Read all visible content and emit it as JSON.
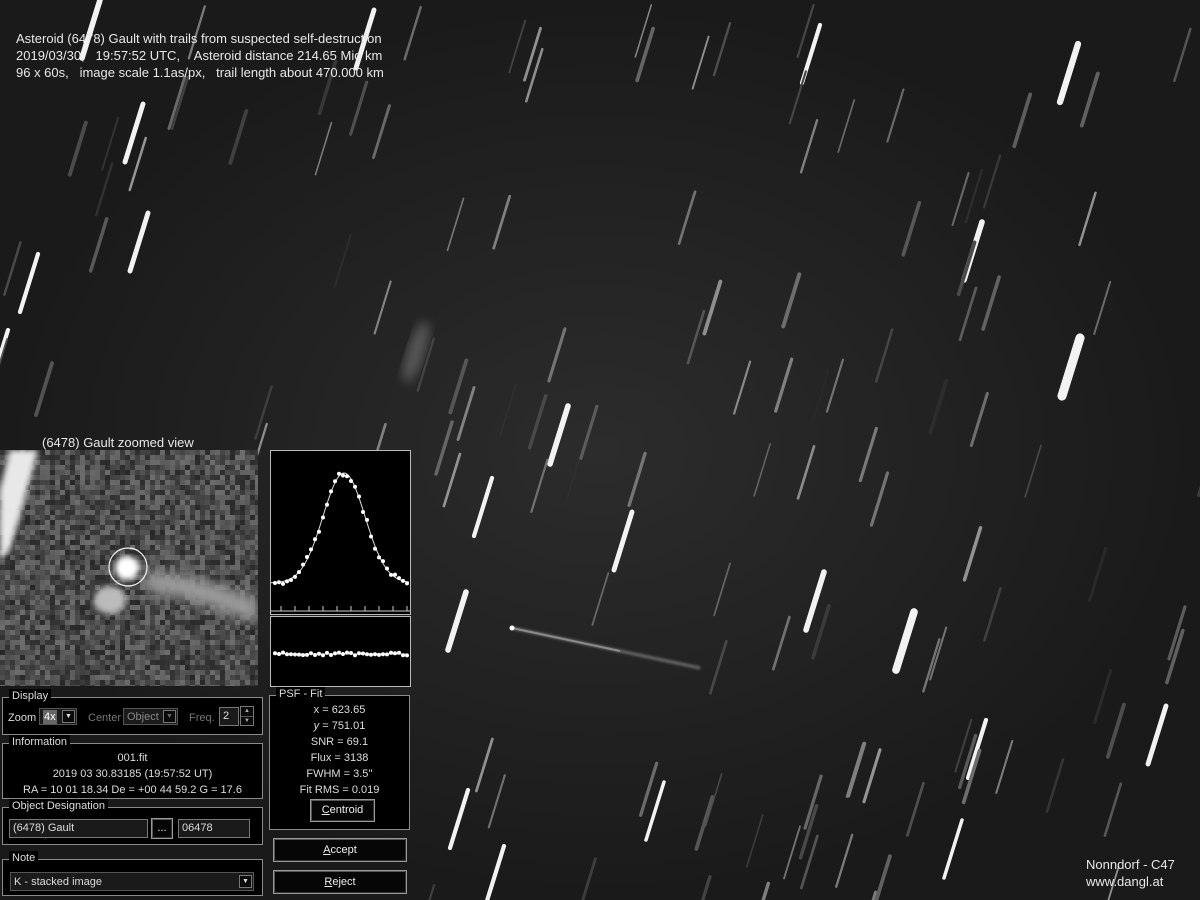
{
  "caption": {
    "line1": "Asteroid (6478) Gault with trails from suspected self-destruction",
    "line2": "2019/03/30,   19:57:52 UTC,    Asteroid distance 214.65 Mio km",
    "line3": "96 x 60s,   image scale 1.1as/px,   trail length about 470.000 km"
  },
  "credit": {
    "line1": "Nonndorf - C47",
    "line2": "www.dangl.at"
  },
  "zoom_view": {
    "title": "(6478) Gault zoomed view"
  },
  "display": {
    "title": "Display",
    "zoom_label": "Zoom",
    "zoom_value": "4x",
    "center_label": "Center",
    "center_value": "Object",
    "freq_label": "Freq.",
    "freq_value": "2"
  },
  "information": {
    "title": "Information",
    "file": "001.fit",
    "date": "2019 03 30.83185 (19:57:52 UT)",
    "coords": "RA = 10 01 18.34   De = +00 44 59.2   G = 17.6"
  },
  "object": {
    "title": "Object Designation",
    "name": "(6478) Gault",
    "browse_label": "...",
    "number": "06478"
  },
  "note": {
    "title": "Note",
    "value": "K - stacked image"
  },
  "psf": {
    "title": "PSF - Fit",
    "x_name": "x",
    "x_value": "= 623.65",
    "y_name": "y",
    "y_value": "= 751.01",
    "snr": "SNR = 69.1",
    "flux": "Flux = 3138",
    "fwhm": "FWHM = 3.5''",
    "rms": "Fit RMS = 0.019",
    "centroid_label": "entroid",
    "centroid_key": "C"
  },
  "buttons": {
    "accept_key": "A",
    "accept_rest": "ccept",
    "reject_key": "R",
    "reject_rest": "eject"
  },
  "colors": {
    "panel": "#000000",
    "frame": "#8a8a8a",
    "text": "#dddddd",
    "sky": "#1c1c1c"
  }
}
